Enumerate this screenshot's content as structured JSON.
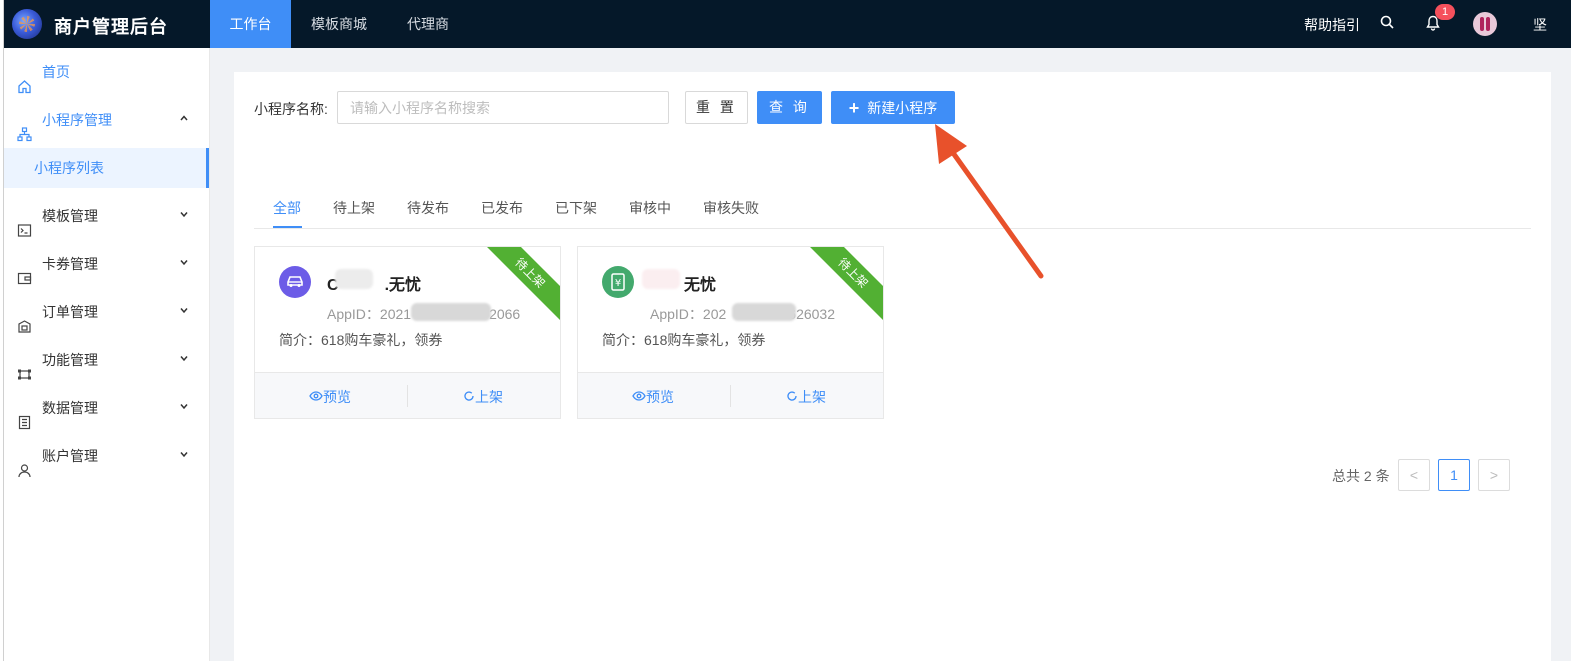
{
  "header": {
    "app_title": "商户管理后台",
    "tabs": [
      {
        "label": "工作台",
        "active": true
      },
      {
        "label": "模板商城",
        "active": false
      },
      {
        "label": "代理商",
        "active": false
      }
    ],
    "help_label": "帮助指引",
    "notification_count": "1",
    "user_name": "坚"
  },
  "sidebar": {
    "items": [
      {
        "label": "首页",
        "icon": "home-icon"
      },
      {
        "label": "小程序管理",
        "icon": "sitemap-icon",
        "expanded": true
      },
      {
        "label": "模板管理",
        "icon": "terminal-icon"
      },
      {
        "label": "卡券管理",
        "icon": "wallet-icon"
      },
      {
        "label": "订单管理",
        "icon": "order-icon"
      },
      {
        "label": "功能管理",
        "icon": "function-icon"
      },
      {
        "label": "数据管理",
        "icon": "data-icon"
      },
      {
        "label": "账户管理",
        "icon": "user-icon"
      }
    ],
    "sub_item": "小程序列表"
  },
  "filter": {
    "label": "小程序名称:",
    "placeholder": "请输入小程序名称搜索",
    "value": "",
    "reset_label": "重 置",
    "query_label": "查 询",
    "new_label": "新建小程序"
  },
  "status_tabs": [
    "全部",
    "待上架",
    "待发布",
    "已发布",
    "已下架",
    "审核中",
    "审核失败"
  ],
  "active_tab": "全部",
  "cards": [
    {
      "title_prefix": "C",
      "title_suffix": ".无忧",
      "appid_prefix": "AppID：2021",
      "appid_suffix": "2066",
      "intro": "简介：618购车豪礼，领券",
      "status": "待上架",
      "icon": "car-icon",
      "icon_color": "#6c5ce7",
      "preview_label": "预览",
      "publish_label": "上架"
    },
    {
      "title_prefix": "",
      "title_suffix": "无忧",
      "appid_prefix": "AppID：202",
      "appid_suffix": "626032",
      "intro": "简介：618购车豪礼，领券",
      "status": "待上架",
      "icon": "yuan-icon",
      "icon_color": "#43a96d",
      "preview_label": "预览",
      "publish_label": "上架"
    }
  ],
  "pagination": {
    "total_label": "总共 2 条",
    "current_page": "1",
    "prev": "<",
    "next": ">"
  },
  "colors": {
    "topbar": "#051829",
    "accent": "#3f8ef7",
    "ribbon": "#52b033",
    "arrow": "#e8512b"
  }
}
